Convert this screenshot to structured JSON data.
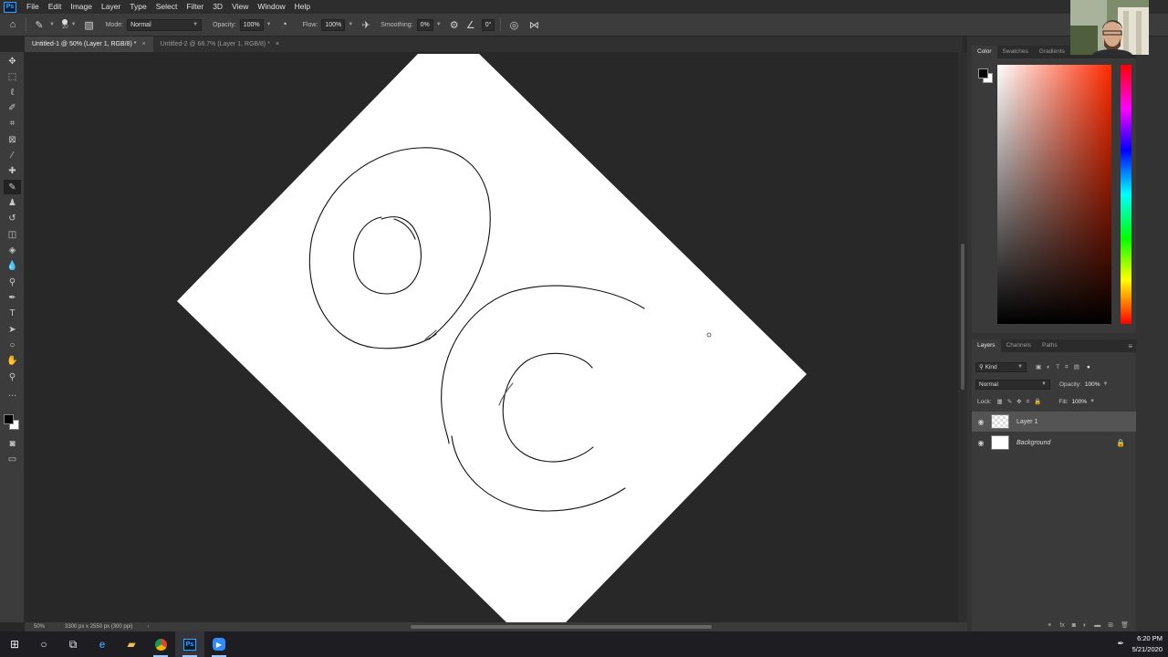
{
  "app": {
    "logo": "Ps",
    "menu": [
      "File",
      "Edit",
      "Image",
      "Layer",
      "Type",
      "Select",
      "Filter",
      "3D",
      "View",
      "Window",
      "Help"
    ]
  },
  "options_bar": {
    "brush_size": "20",
    "mode_label": "Mode:",
    "mode_value": "Normal",
    "opacity_label": "Opacity:",
    "opacity_value": "100%",
    "flow_label": "Flow:",
    "flow_value": "100%",
    "smoothing_label": "Smoothing:",
    "smoothing_value": "0%",
    "angle_value": "0°"
  },
  "documents": {
    "tabs": [
      {
        "title": "Untitled-1 @ 50% (Layer 1, RGB/8) *",
        "active": true
      },
      {
        "title": "Untitled-2 @ 66.7% (Layer 1, RGB/8) *",
        "active": false
      }
    ]
  },
  "status_bar": {
    "zoom": "50%",
    "doc_info": "3300 px x 2550 px (300 ppi)"
  },
  "color_panel": {
    "tabs": [
      "Color",
      "Swatches",
      "Gradients"
    ],
    "foreground_color": "#000000",
    "background_color": "#ffffff",
    "picker_hue": "#ff2a00"
  },
  "layers_panel": {
    "tabs": [
      "Layers",
      "Channels",
      "Paths"
    ],
    "filter_kind": "Kind",
    "blend_mode": "Normal",
    "opacity_label": "Opacity:",
    "opacity_value": "100%",
    "lock_label": "Lock:",
    "fill_label": "Fill:",
    "fill_value": "100%",
    "layers": [
      {
        "name": "Layer 1",
        "selected": true,
        "locked": false
      },
      {
        "name": "Background",
        "selected": false,
        "locked": true
      }
    ]
  },
  "taskbar": {
    "time": "6:20 PM",
    "date": "5/21/2020"
  }
}
